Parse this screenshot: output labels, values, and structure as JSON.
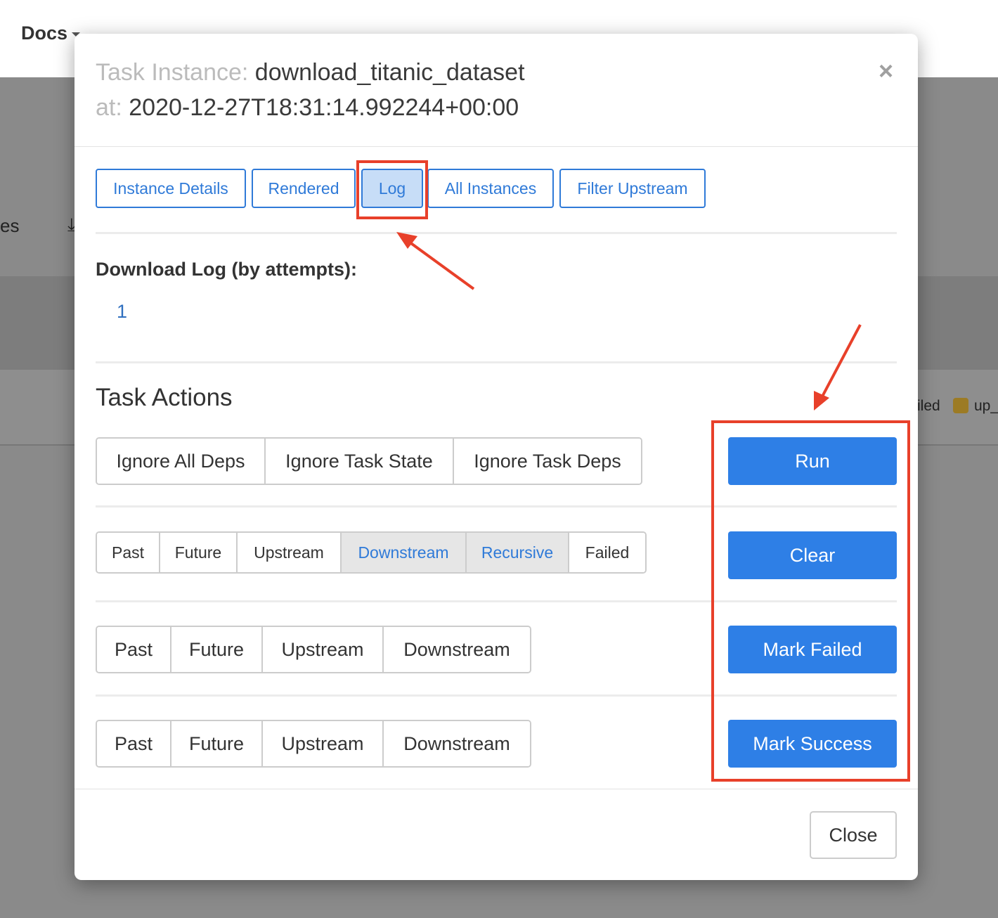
{
  "background": {
    "docs_label": "Docs",
    "left_fragment": "es",
    "legend_failed_fragment": "iled",
    "legend_up_fragment": "up_",
    "legend_swatch_color": "#9c7b25"
  },
  "modal": {
    "title_label": "Task Instance:",
    "title_value": "download_titanic_dataset",
    "at_label": "at:",
    "at_value": "2020-12-27T18:31:14.992244+00:00",
    "close_icon_glyph": "×",
    "nav_tabs": [
      {
        "label": "Instance Details",
        "active": false
      },
      {
        "label": "Rendered",
        "active": false
      },
      {
        "label": "Log",
        "active": true
      },
      {
        "label": "All Instances",
        "active": false
      },
      {
        "label": "Filter Upstream",
        "active": false
      }
    ],
    "log_heading": "Download Log (by attempts):",
    "log_attempts": [
      "1"
    ],
    "actions_heading": "Task Actions",
    "run_options": [
      "Ignore All Deps",
      "Ignore Task State",
      "Ignore Task Deps"
    ],
    "clear_options": [
      {
        "label": "Past",
        "active": false
      },
      {
        "label": "Future",
        "active": false
      },
      {
        "label": "Upstream",
        "active": false
      },
      {
        "label": "Downstream",
        "active": true
      },
      {
        "label": "Recursive",
        "active": true
      },
      {
        "label": "Failed",
        "active": false
      }
    ],
    "mark_failed_options": [
      "Past",
      "Future",
      "Upstream",
      "Downstream"
    ],
    "mark_success_options": [
      "Past",
      "Future",
      "Upstream",
      "Downstream"
    ],
    "action_buttons": {
      "run": "Run",
      "clear": "Clear",
      "mark_failed": "Mark Failed",
      "mark_success": "Mark Success"
    },
    "footer_close": "Close"
  },
  "colors": {
    "primary": "#2e7fe6",
    "link": "#2f7ad8",
    "annotation": "#e8402a"
  }
}
